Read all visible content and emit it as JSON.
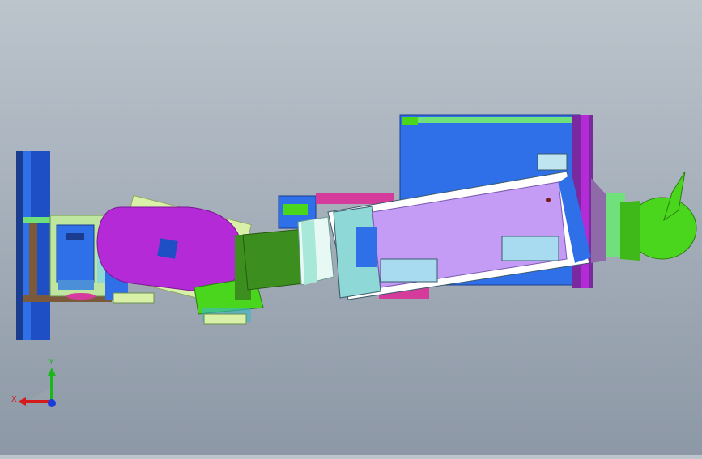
{
  "viewport": {
    "background_top": "#bcc4cc",
    "background_bottom": "#8d98a6"
  },
  "triad": {
    "x_label": "X",
    "y_label": "Y",
    "x_color": "#d41a1a",
    "y_color": "#18b818",
    "z_color": "#1a3cdc"
  },
  "model": {
    "part_colors": {
      "blue": "#2f6fe8",
      "purple": "#b32ad6",
      "lavender": "#c49cf5",
      "green": "#4bd61e",
      "dark_green": "#3c8f1e",
      "pink": "#d43b9a",
      "light_blue": "#a8dbf0",
      "brown": "#7a5a3a",
      "cyan": "#3bb7c9"
    }
  }
}
